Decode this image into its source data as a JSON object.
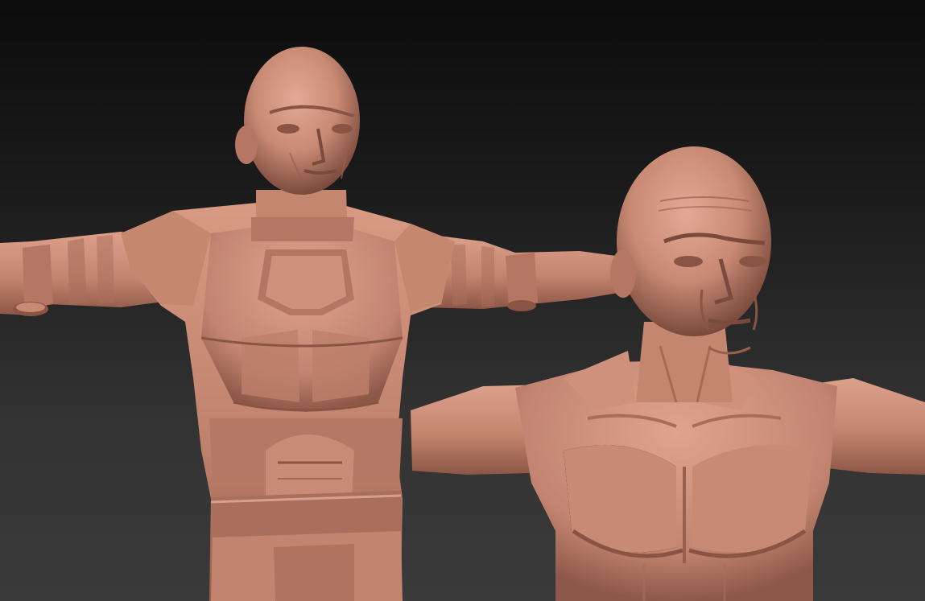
{
  "scene": {
    "background_top_color": "#0c0c0c",
    "background_bottom_color": "#3a3a3a",
    "clay_color": "#c98a74",
    "clay_shadow_color": "#8a5444",
    "clay_highlight_color": "#e2a994",
    "figures": [
      {
        "id": "armored-figure",
        "pose": "t-pose"
      },
      {
        "id": "bare-torso-figure",
        "pose": "t-pose"
      }
    ]
  }
}
